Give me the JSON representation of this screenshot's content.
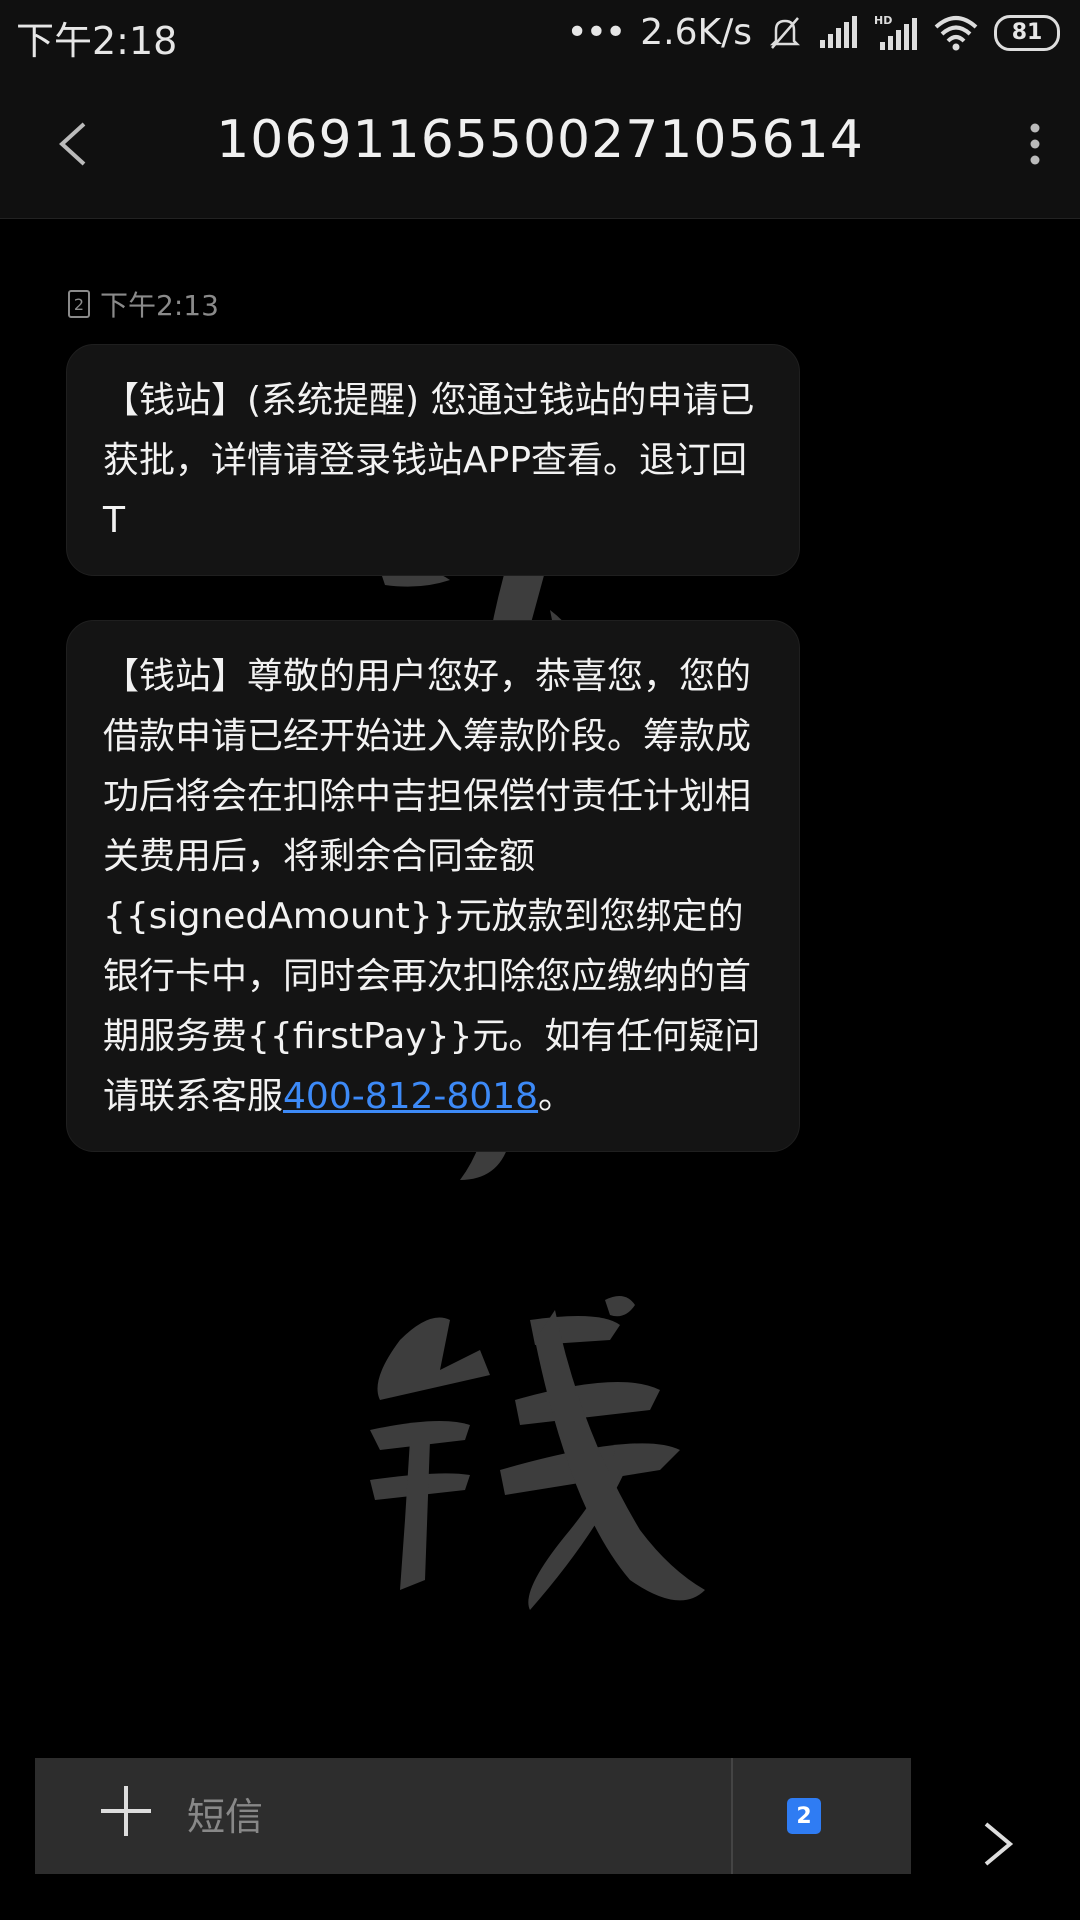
{
  "status": {
    "time": "下午2:18",
    "speed": "2.6K/s",
    "battery": "81"
  },
  "header": {
    "title": "10691165500271056​14"
  },
  "messages": {
    "timestamp": "下午2:13",
    "sim_number": "2",
    "msg1": "【钱站】(系统提醒) 您通过钱站的申请已获批，详情请登录钱站APP查看。退订回T",
    "msg2_text": "【钱站】尊敬的用户您好，恭喜您，您的借款申请已经开始进入筹款阶段。筹款成功后将会在扣除中吉担保偿付责任计划相关费用后，将剩余合同金额{{signedAmount}}元放款到您绑定的银行卡中，同时会再次扣除您应缴纳的首期服务费{{firstPay}}元。如有任何疑问请联系客服",
    "msg2_link": "400-812-8018",
    "msg2_end": "。"
  },
  "input": {
    "placeholder": "短信",
    "sim_badge": "2"
  },
  "colors": {
    "link": "#3d8af7",
    "sim_badge": "#2f7cf3"
  }
}
